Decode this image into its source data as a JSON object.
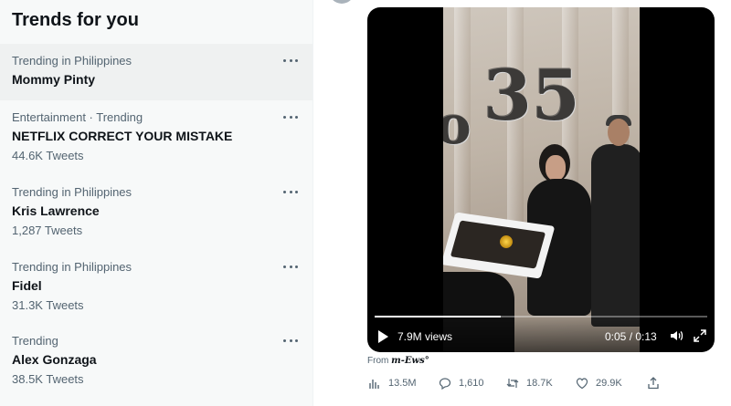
{
  "trends_panel": {
    "title": "Trends for you",
    "items": [
      {
        "meta": "Trending in Philippines",
        "name": "Mommy Pinty",
        "count": ""
      },
      {
        "meta": "Entertainment · Trending",
        "name": "NETFLIX CORRECT YOUR MISTAKE",
        "count": "44.6K Tweets"
      },
      {
        "meta": "Trending in Philippines",
        "name": "Kris Lawrence",
        "count": "1,287 Tweets"
      },
      {
        "meta": "Trending in Philippines",
        "name": "Fidel",
        "count": "31.3K Tweets"
      },
      {
        "meta": "Trending",
        "name": "Alex Gonzaga",
        "count": "38.5K Tweets"
      }
    ],
    "more_icon": "more-horizontal-icon"
  },
  "video": {
    "views": "7.9M views",
    "time": "0:05 / 0:13",
    "progress": 0.38,
    "icons": [
      "play-icon",
      "volume-icon",
      "fullscreen-icon"
    ]
  },
  "source": {
    "prefix": "From",
    "brand": "m-Ews°"
  },
  "actions": {
    "analytics": "13.5M",
    "replies": "1,610",
    "retweets": "18.7K",
    "likes": "29.9K"
  },
  "colors": {
    "secondary_text": "#536471",
    "primary_text": "#0f1419",
    "panel_bg": "#f7f9f9"
  }
}
